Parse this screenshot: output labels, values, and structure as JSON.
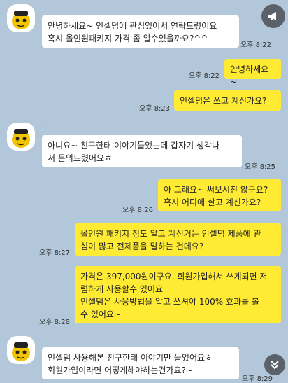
{
  "messages": [
    {
      "side": "in",
      "sender": ".",
      "text": "안녕하세요~ 인셀덤에 관심있어서 연락드렸어요\n혹시 올인원패키지 가격 좀 알수있을까요?^^",
      "time": "오후 8:22",
      "first": true
    },
    {
      "side": "out",
      "text": "안녕하세요~",
      "time": "오후 8:22"
    },
    {
      "side": "out",
      "text": "인셀덤은 쓰고 계신가요?",
      "time": "오후 8:23"
    },
    {
      "side": "in",
      "sender": ".",
      "text": "아니요~ 친구한태 이야기들었는데 갑자기 생각나\n서 문의드렸어요ㅎ",
      "time": "오후 8:25",
      "first": true
    },
    {
      "side": "out",
      "text": "아 그래요~ 써보시진 않구요?\n혹시 어디에 살고 계신가요?",
      "time": "오후 8:26"
    },
    {
      "side": "out",
      "text": "올인원 패키지 정도 알고 계신거는 인셀덤 제품에 관\n심이 많고 전제품을 말하는 건데요?",
      "time": "오후 8:27"
    },
    {
      "side": "out",
      "text": "가격은 397,000원이구요. 회원가입해서 쓰게되면 저\n렴하게 사용할수 있어요\n인셀덤은 사용방법을 알고 쓰셔야 100% 효과를 볼\n수 있어요~",
      "time": "오후 8:28"
    },
    {
      "side": "in",
      "sender": ".",
      "text": "인셀덤 사용해본 친구한태 이야기만 들었어요ㅎ\n회원가입이라면 어떻게해야하는건가요?~",
      "time": "오후 8:29",
      "first": true
    }
  ],
  "controls": {
    "speaker_icon": "megaphone-icon",
    "scroll_icon": "double-chevron-down-icon"
  }
}
